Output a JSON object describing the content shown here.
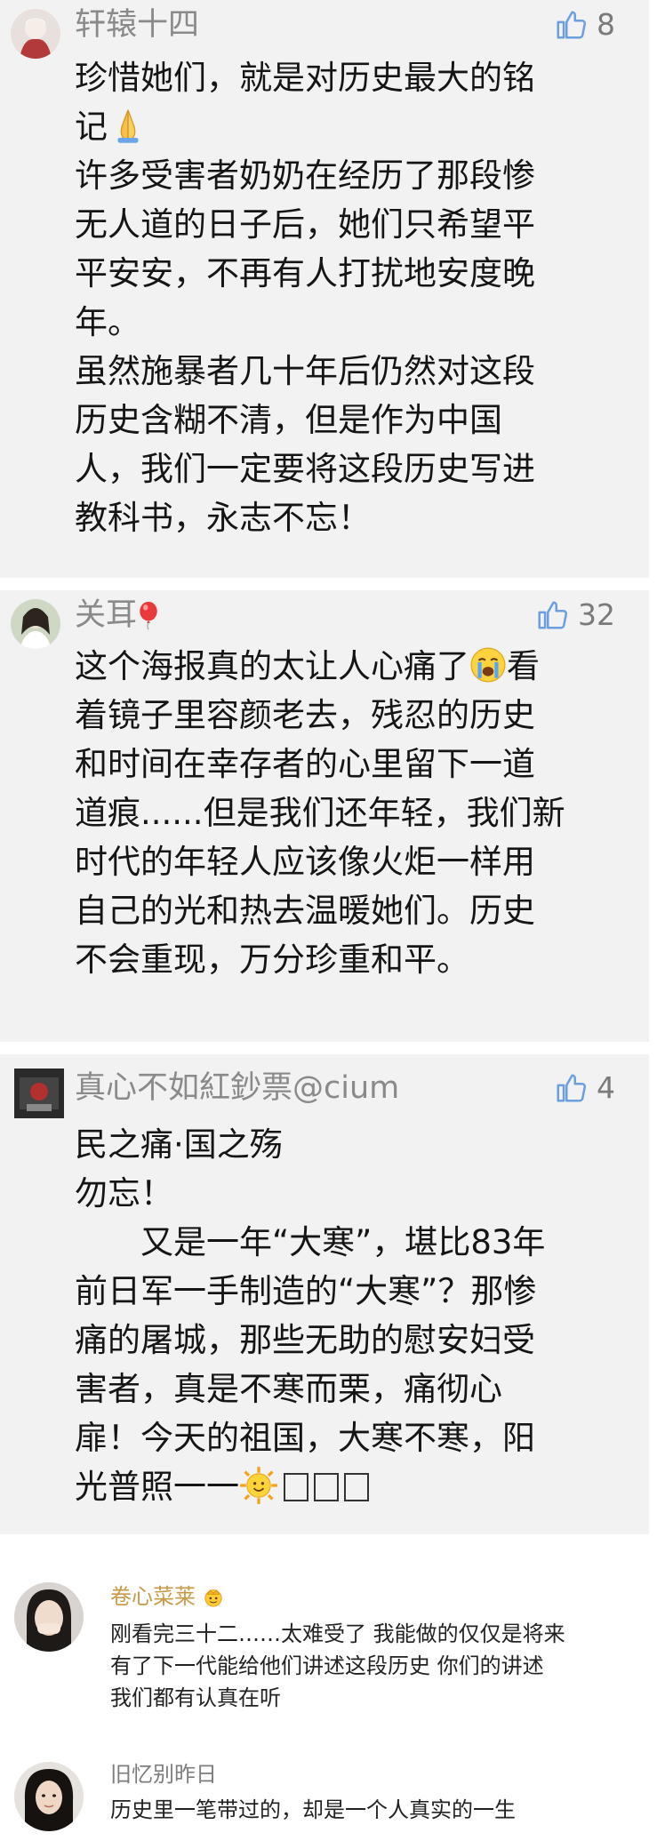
{
  "comments": [
    {
      "username": "轩辕十四",
      "likes": "8",
      "lines": [
        "珍惜她们，就是对历史最大的铭",
        "记",
        "许多受害者奶奶在经历了那段惨",
        "无人道的日子后，她们只希望平",
        "平安安，不再有人打扰地安度晚",
        "年。",
        "虽然施暴者几十年后仍然对这段",
        "历史含糊不清，但是作为中国",
        "人，我们一定要将这段历史写进",
        "教科书，永志不忘！"
      ],
      "emoji_after_line_2": "folded-hands"
    },
    {
      "username": "关耳",
      "username_emoji": "balloon",
      "likes": "32",
      "lines": [
        "这个海报真的太让人心痛了",
        "着镜子里容颜老去，残忍的历史",
        "和时间在幸存者的心里留下一道",
        "道痕......但是我们还年轻，我们新",
        "时代的年轻人应该像火炬一样用",
        "自己的光和热去温暖她们。历史",
        "不会重现，万分珍重和平。"
      ],
      "line1_tail": "看",
      "emoji_in_line_1": "crying-face"
    },
    {
      "username": "真心不如紅鈔票@cium",
      "likes": "4",
      "lines": [
        "民之痛·国之殇",
        "勿忘！",
        "　　又是一年“大寒”，堪比83年",
        "前日军一手制造的“大寒”？那惨",
        "痛的屠城，那些无助的慰安妇受",
        "害者，真是不寒而栗，痛彻心",
        "扉！今天的祖国，大寒不寒，阳",
        "光普照一一"
      ],
      "last_line_emoji": "sun-face"
    }
  ],
  "small_comments": [
    {
      "username": "卷心菜莱",
      "username_emoji": "crown",
      "lines": [
        "刚看完三十二……太难受了  我能做的仅仅是将来",
        "有了下一代能给他们讲述这段历史  你们的讲述",
        "我们都有认真在听"
      ]
    },
    {
      "username": "旧忆别昨日",
      "lines": [
        "历史里一笔带过的，却是一个人真实的一生"
      ]
    }
  ],
  "colors": {
    "card_bg": "#f2f2f2",
    "username_gray": "#8a8a8a",
    "username_gold": "#c89a45"
  }
}
